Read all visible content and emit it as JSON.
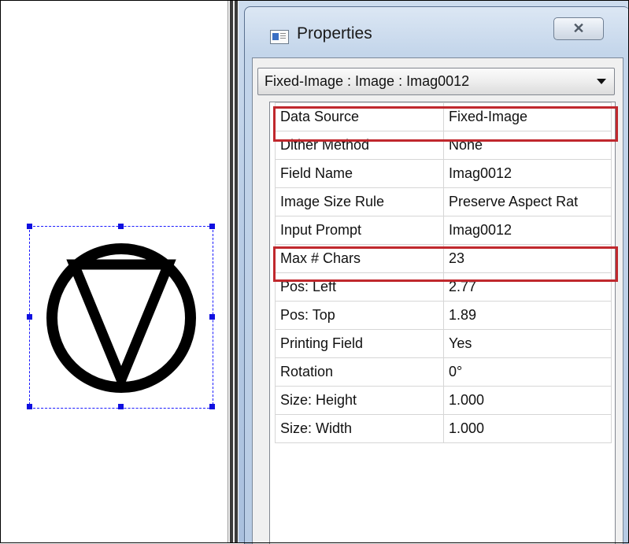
{
  "window": {
    "title": "Properties",
    "close_symbol": "✕",
    "icon": "properties-window-icon"
  },
  "selector": {
    "value": "Fixed-Image : Image : Imag0012"
  },
  "properties": [
    {
      "name": "Data Source",
      "value": "Fixed-Image"
    },
    {
      "name": "Dither Method",
      "value": "None"
    },
    {
      "name": "Field Name",
      "value": "Imag0012"
    },
    {
      "name": "Image Size Rule",
      "value": "Preserve  Aspect Rat"
    },
    {
      "name": "Input Prompt",
      "value": "Imag0012"
    },
    {
      "name": "Max # Chars",
      "value": "23"
    },
    {
      "name": "Pos: Left",
      "value": "2.77"
    },
    {
      "name": "Pos: Top",
      "value": "1.89"
    },
    {
      "name": "Printing Field",
      "value": "Yes"
    },
    {
      "name": "Rotation",
      "value": "0°"
    },
    {
      "name": "Size: Height",
      "value": "1.000"
    },
    {
      "name": "Size: Width",
      "value": "1.000"
    }
  ],
  "canvas": {
    "symbol_icon": "circle-inverted-triangle-icon",
    "selection_color": "#1a1aff"
  },
  "colors": {
    "highlight": "#c0282d"
  }
}
